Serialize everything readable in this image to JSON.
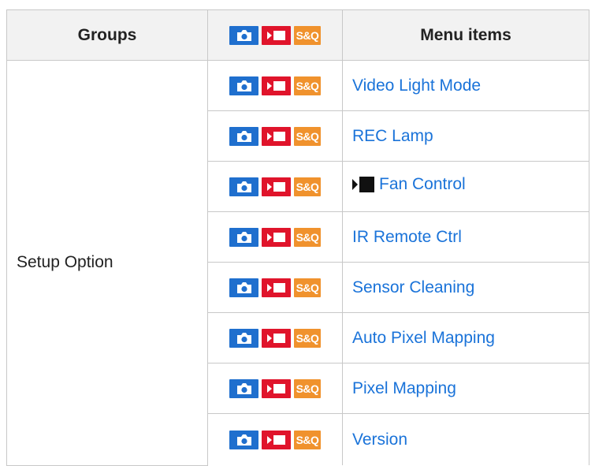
{
  "colors": {
    "photo_badge": "#1f6fce",
    "movie_badge": "#e0142b",
    "sq_badge": "#f0922d",
    "link": "#1a73d9",
    "header_bg": "#f2f2f2",
    "border": "#c8c8c8"
  },
  "table": {
    "headers": {
      "groups": "Groups",
      "menu_items": "Menu items"
    },
    "mode_icons": {
      "photo": "camera-icon",
      "movie": "movie-camera-icon",
      "sq": "S&Q"
    },
    "group": "Setup Option",
    "rows": [
      {
        "label": "Video Light Mode"
      },
      {
        "label": "REC Lamp"
      },
      {
        "label": "Fan Control",
        "prefix_icon": "movie-mode-icon"
      },
      {
        "label": "IR Remote Ctrl"
      },
      {
        "label": "Sensor Cleaning"
      },
      {
        "label": "Auto Pixel Mapping"
      },
      {
        "label": "Pixel Mapping"
      },
      {
        "label": "Version"
      }
    ]
  }
}
